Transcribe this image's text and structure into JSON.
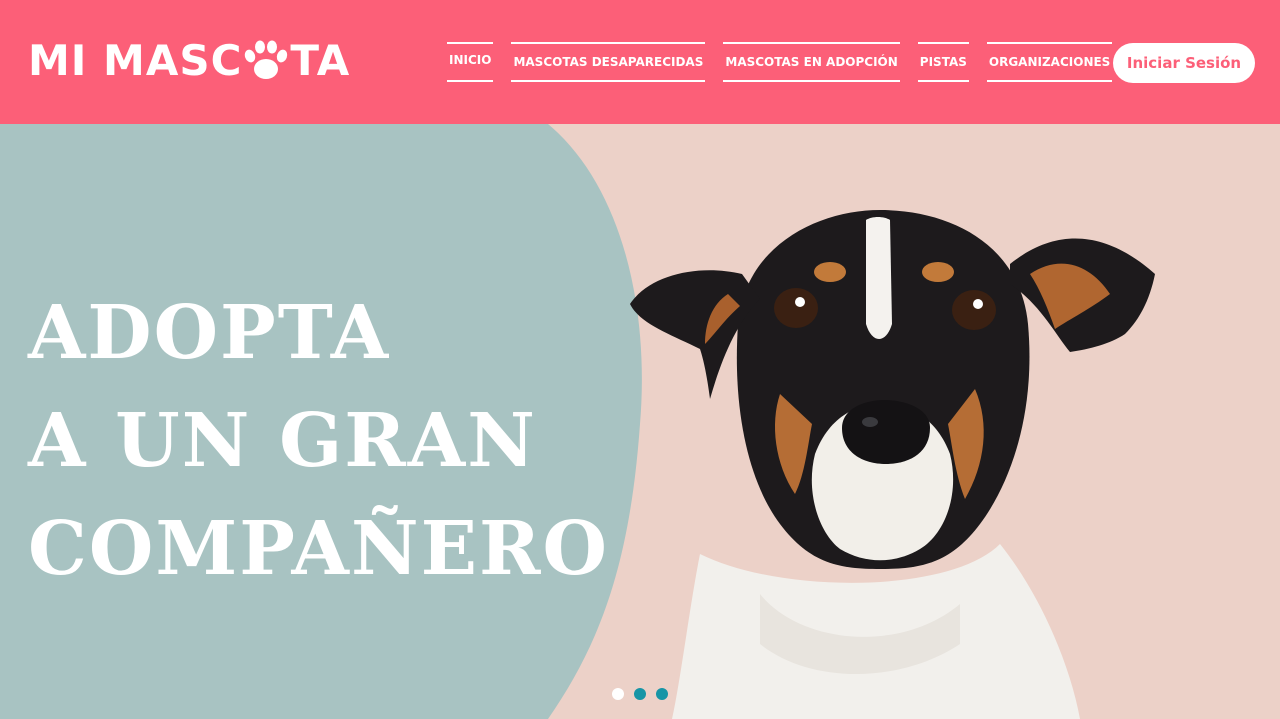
{
  "brand": {
    "name_before": "MI MASC",
    "name_after": "TA",
    "logo_icon": "paw-print-icon"
  },
  "nav": {
    "items": [
      {
        "label": "INICIO"
      },
      {
        "label": "MASCOTAS DESAPARECIDAS"
      },
      {
        "label": "MASCOTAS EN ADOPCIÓN"
      },
      {
        "label": "PISTAS"
      },
      {
        "label": "ORGANIZACIONES"
      }
    ],
    "login_label": "Iniciar Sesión"
  },
  "hero": {
    "title_lines": [
      "ADOPTA",
      "A UN GRAN",
      "COMPAÑERO"
    ],
    "image": "dog-portrait-photo",
    "carousel": {
      "total": 3,
      "active_index": 0
    }
  },
  "colors": {
    "header_bg": "#fc5f78",
    "hero_panel": "#a8c3c2",
    "hero_bg": "#ecd1c8",
    "dot_active": "#ffffff",
    "dot_inactive": "#1795a6"
  }
}
